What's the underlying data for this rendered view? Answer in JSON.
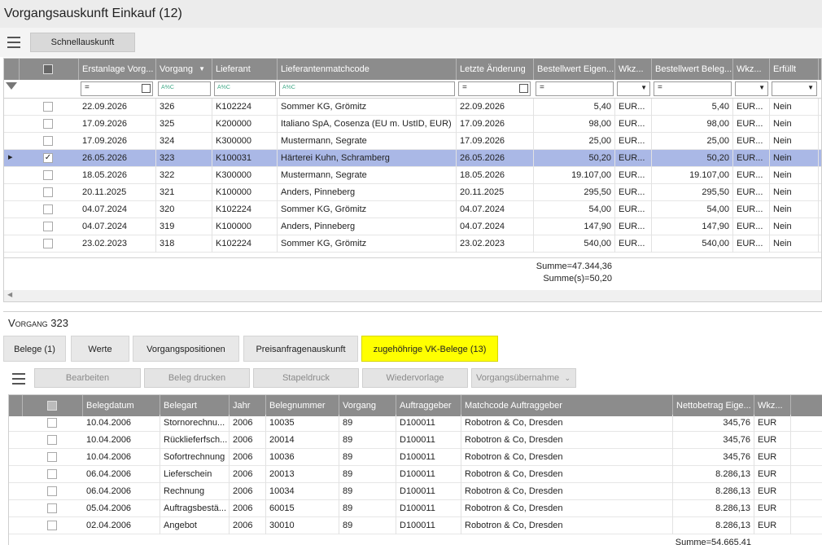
{
  "app_title": "Vorgangsauskunft Einkauf (12)",
  "toolbar": {
    "quick_button": "Schnellauskunft"
  },
  "top_grid": {
    "columns": [
      "Erstanlage Vorg...",
      "Vorgang",
      "Lieferant",
      "Lieferantenmatchcode",
      "Letzte Änderung",
      "Bestellwert Eigen...",
      "Wkz...",
      "Bestellwert Beleg...",
      "Wkz...",
      "Erfüllt"
    ],
    "filter_placeholder": "A%C",
    "rows": [
      {
        "date": "22.09.2026",
        "vorgang": "326",
        "lief": "K102224",
        "match": "Sommer KG, Grömitz",
        "change": "22.09.2026",
        "wert": "5,40",
        "wkz": "EUR...",
        "wert2": "5,40",
        "wkz2": "EUR...",
        "erf": "Nein"
      },
      {
        "date": "17.09.2026",
        "vorgang": "325",
        "lief": "K200000",
        "match": "Italiano SpA, Cosenza (EU m. UstID, EUR)",
        "change": "17.09.2026",
        "wert": "98,00",
        "wkz": "EUR...",
        "wert2": "98,00",
        "wkz2": "EUR...",
        "erf": "Nein"
      },
      {
        "date": "17.09.2026",
        "vorgang": "324",
        "lief": "K300000",
        "match": "Mustermann, Segrate",
        "change": "17.09.2026",
        "wert": "25,00",
        "wkz": "EUR...",
        "wert2": "25,00",
        "wkz2": "EUR...",
        "erf": "Nein"
      },
      {
        "date": "26.05.2026",
        "vorgang": "323",
        "lief": "K100031",
        "match": "Härterei Kuhn, Schramberg",
        "change": "26.05.2026",
        "wert": "50,20",
        "wkz": "EUR...",
        "wert2": "50,20",
        "wkz2": "EUR...",
        "erf": "Nein"
      },
      {
        "date": "18.05.2026",
        "vorgang": "322",
        "lief": "K300000",
        "match": "Mustermann, Segrate",
        "change": "18.05.2026",
        "wert": "19.107,00",
        "wkz": "EUR...",
        "wert2": "19.107,00",
        "wkz2": "EUR...",
        "erf": "Nein"
      },
      {
        "date": "20.11.2025",
        "vorgang": "321",
        "lief": "K100000",
        "match": "Anders, Pinneberg",
        "change": "20.11.2025",
        "wert": "295,50",
        "wkz": "EUR...",
        "wert2": "295,50",
        "wkz2": "EUR...",
        "erf": "Nein"
      },
      {
        "date": "04.07.2024",
        "vorgang": "320",
        "lief": "K102224",
        "match": "Sommer KG, Grömitz",
        "change": "04.07.2024",
        "wert": "54,00",
        "wkz": "EUR...",
        "wert2": "54,00",
        "wkz2": "EUR...",
        "erf": "Nein"
      },
      {
        "date": "04.07.2024",
        "vorgang": "319",
        "lief": "K100000",
        "match": "Anders, Pinneberg",
        "change": "04.07.2024",
        "wert": "147,90",
        "wkz": "EUR...",
        "wert2": "147,90",
        "wkz2": "EUR...",
        "erf": "Nein"
      },
      {
        "date": "23.02.2023",
        "vorgang": "318",
        "lief": "K102224",
        "match": "Sommer KG, Grömitz",
        "change": "23.02.2023",
        "wert": "540,00",
        "wkz": "EUR...",
        "wert2": "540,00",
        "wkz2": "EUR...",
        "erf": "Nein"
      }
    ],
    "selected_row": 3,
    "sum1": "Summe=47.344,36",
    "sum2": "Summe(s)=50,20"
  },
  "detail": {
    "title": "Vorgang 323",
    "tabs": [
      "Belege (1)",
      "Werte",
      "Vorgangspositionen",
      "Preisanfragenauskunft",
      "zugehöhrige VK-Belege (13)"
    ],
    "active_tab": 4,
    "buttons": [
      "Bearbeiten",
      "Beleg drucken",
      "Stapeldruck",
      "Wiedervorlage",
      "Vorgangsübernahme"
    ],
    "columns": [
      "Belegdatum",
      "Belegart",
      "Jahr",
      "Belegnummer",
      "Vorgang",
      "Auftraggeber",
      "Matchcode Auftraggeber",
      "Nettobetrag Eige...",
      "Wkz..."
    ],
    "rows": [
      {
        "date": "10.04.2006",
        "art": "Stornorechnu...",
        "jahr": "2006",
        "nr": "10035",
        "vorg": "89",
        "ag": "D100011",
        "match": "Robotron & Co, Dresden",
        "betrag": "345,76",
        "wkz": "EUR"
      },
      {
        "date": "10.04.2006",
        "art": "Rücklieferfsch...",
        "jahr": "2006",
        "nr": "20014",
        "vorg": "89",
        "ag": "D100011",
        "match": "Robotron & Co, Dresden",
        "betrag": "345,76",
        "wkz": "EUR"
      },
      {
        "date": "10.04.2006",
        "art": "Sofortrechnung",
        "jahr": "2006",
        "nr": "10036",
        "vorg": "89",
        "ag": "D100011",
        "match": "Robotron & Co, Dresden",
        "betrag": "345,76",
        "wkz": "EUR"
      },
      {
        "date": "06.04.2006",
        "art": "Lieferschein",
        "jahr": "2006",
        "nr": "20013",
        "vorg": "89",
        "ag": "D100011",
        "match": "Robotron & Co, Dresden",
        "betrag": "8.286,13",
        "wkz": "EUR"
      },
      {
        "date": "06.04.2006",
        "art": "Rechnung",
        "jahr": "2006",
        "nr": "10034",
        "vorg": "89",
        "ag": "D100011",
        "match": "Robotron & Co, Dresden",
        "betrag": "8.286,13",
        "wkz": "EUR"
      },
      {
        "date": "05.04.2006",
        "art": "Auftragsbestä...",
        "jahr": "2006",
        "nr": "60015",
        "vorg": "89",
        "ag": "D100011",
        "match": "Robotron & Co, Dresden",
        "betrag": "8.286,13",
        "wkz": "EUR"
      },
      {
        "date": "02.04.2006",
        "art": "Angebot",
        "jahr": "2006",
        "nr": "30010",
        "vorg": "89",
        "ag": "D100011",
        "match": "Robotron & Co, Dresden",
        "betrag": "8.286,13",
        "wkz": "EUR"
      }
    ],
    "sum": "Summe=54.665,41"
  }
}
